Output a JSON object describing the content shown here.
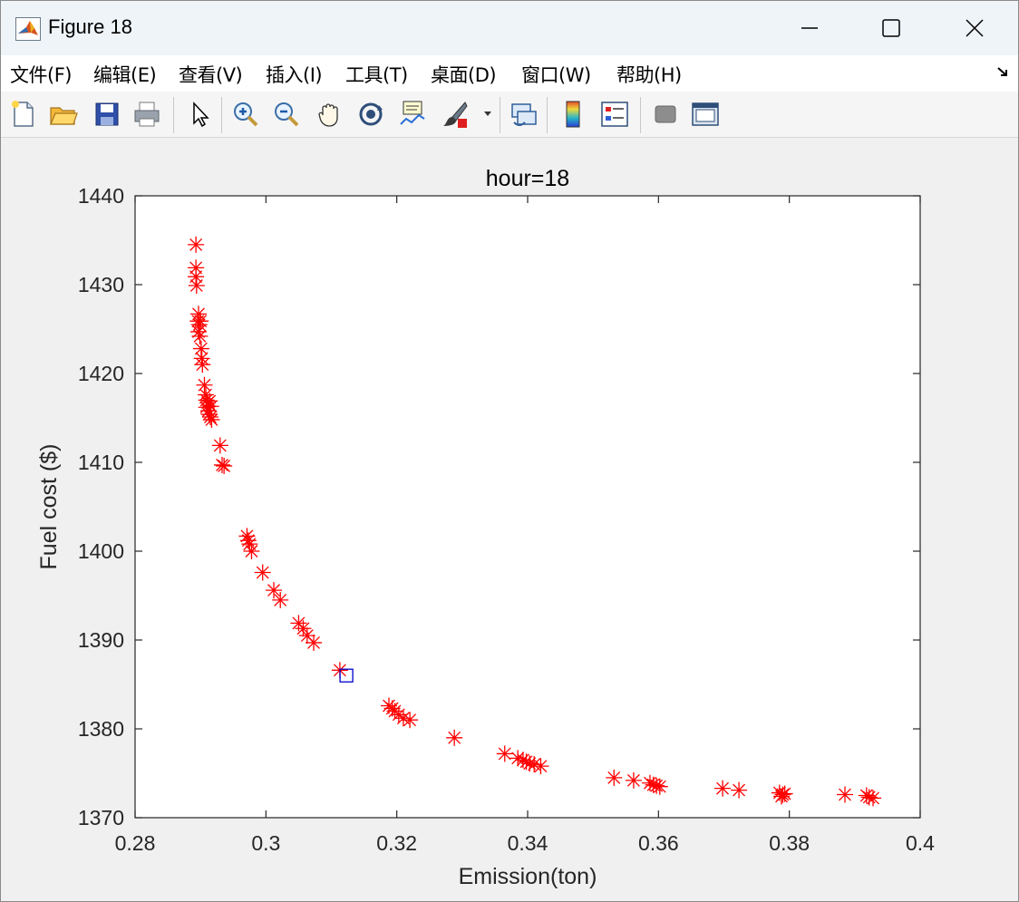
{
  "window": {
    "title": "Figure 18"
  },
  "menu": {
    "items": [
      "文件(F)",
      "编辑(E)",
      "查看(V)",
      "插入(I)",
      "工具(T)",
      "桌面(D)",
      "窗口(W)",
      "帮助(H)"
    ]
  },
  "toolbar": {
    "buttons": [
      "new-figure-icon",
      "open-file-icon",
      "save-icon",
      "print-icon",
      "pointer-icon",
      "zoom-in-icon",
      "zoom-out-icon",
      "pan-icon",
      "rotate-3d-icon",
      "data-cursor-icon",
      "brush-icon",
      "link-plot-icon",
      "colorbar-icon",
      "legend-icon",
      "hide-plot-tools-icon",
      "show-plot-tools-icon"
    ]
  },
  "colors": {
    "marker": "#ff0000",
    "selected_marker": "#0000cc",
    "axes_bg": "#ffffff",
    "figure_bg": "#f0f0f0"
  },
  "chart_data": {
    "type": "scatter",
    "title": "hour=18",
    "xlabel": "Emission(ton)",
    "ylabel": "Fuel cost ($)",
    "xlim": [
      0.28,
      0.4
    ],
    "ylim": [
      1370,
      1440
    ],
    "xticks": [
      "0.28",
      "0.3",
      "0.32",
      "0.34",
      "0.36",
      "0.38",
      "0.4"
    ],
    "yticks": [
      "1370",
      "1380",
      "1390",
      "1400",
      "1410",
      "1420",
      "1430",
      "1440"
    ],
    "grid": false,
    "legend": "none",
    "series": [
      {
        "marker": "asterisk",
        "color": "#ff0000",
        "points": [
          [
            0.2893,
            1434.5
          ],
          [
            0.2893,
            1431.9
          ],
          [
            0.2893,
            1430.9
          ],
          [
            0.2894,
            1429.9
          ],
          [
            0.2897,
            1426.7
          ],
          [
            0.2896,
            1425.9
          ],
          [
            0.2898,
            1425.5
          ],
          [
            0.29,
            1425.9
          ],
          [
            0.2897,
            1424.7
          ],
          [
            0.2899,
            1424.2
          ],
          [
            0.2901,
            1422.8
          ],
          [
            0.2902,
            1421.7
          ],
          [
            0.2903,
            1421.0
          ],
          [
            0.2906,
            1418.7
          ],
          [
            0.2908,
            1417.6
          ],
          [
            0.2909,
            1417.0
          ],
          [
            0.2911,
            1416.7
          ],
          [
            0.2909,
            1416.2
          ],
          [
            0.2912,
            1415.8
          ],
          [
            0.2913,
            1415.4
          ],
          [
            0.2915,
            1415.1
          ],
          [
            0.2917,
            1414.8
          ],
          [
            0.2914,
            1416.9
          ],
          [
            0.2916,
            1416.3
          ],
          [
            0.293,
            1411.9
          ],
          [
            0.2933,
            1409.7
          ],
          [
            0.2936,
            1409.6
          ],
          [
            0.2971,
            1401.7
          ],
          [
            0.2973,
            1401.2
          ],
          [
            0.2975,
            1400.8
          ],
          [
            0.2978,
            1400.0
          ],
          [
            0.2995,
            1397.6
          ],
          [
            0.3012,
            1395.6
          ],
          [
            0.3022,
            1394.5
          ],
          [
            0.305,
            1391.9
          ],
          [
            0.3057,
            1391.3
          ],
          [
            0.3063,
            1390.5
          ],
          [
            0.3073,
            1389.7
          ],
          [
            0.3113,
            1386.6
          ],
          [
            0.3188,
            1382.6
          ],
          [
            0.3193,
            1382.3
          ],
          [
            0.3197,
            1382.0
          ],
          [
            0.3203,
            1381.6
          ],
          [
            0.321,
            1381.2
          ],
          [
            0.322,
            1381.0
          ],
          [
            0.3288,
            1379.0
          ],
          [
            0.3365,
            1377.2
          ],
          [
            0.3385,
            1376.7
          ],
          [
            0.3393,
            1376.5
          ],
          [
            0.3398,
            1376.3
          ],
          [
            0.3403,
            1376.1
          ],
          [
            0.341,
            1376.0
          ],
          [
            0.342,
            1375.8
          ],
          [
            0.3532,
            1374.5
          ],
          [
            0.3562,
            1374.2
          ],
          [
            0.3587,
            1373.9
          ],
          [
            0.3592,
            1373.7
          ],
          [
            0.3597,
            1373.6
          ],
          [
            0.3602,
            1373.5
          ],
          [
            0.3698,
            1373.3
          ],
          [
            0.3723,
            1373.1
          ],
          [
            0.3785,
            1372.8
          ],
          [
            0.379,
            1372.6
          ],
          [
            0.3793,
            1372.7
          ],
          [
            0.3788,
            1372.4
          ],
          [
            0.3885,
            1372.6
          ],
          [
            0.3918,
            1372.5
          ],
          [
            0.3922,
            1372.3
          ],
          [
            0.3928,
            1372.2
          ]
        ]
      },
      {
        "marker": "square",
        "color": "#0000cc",
        "points": [
          [
            0.3123,
            1386.0
          ]
        ]
      }
    ]
  }
}
